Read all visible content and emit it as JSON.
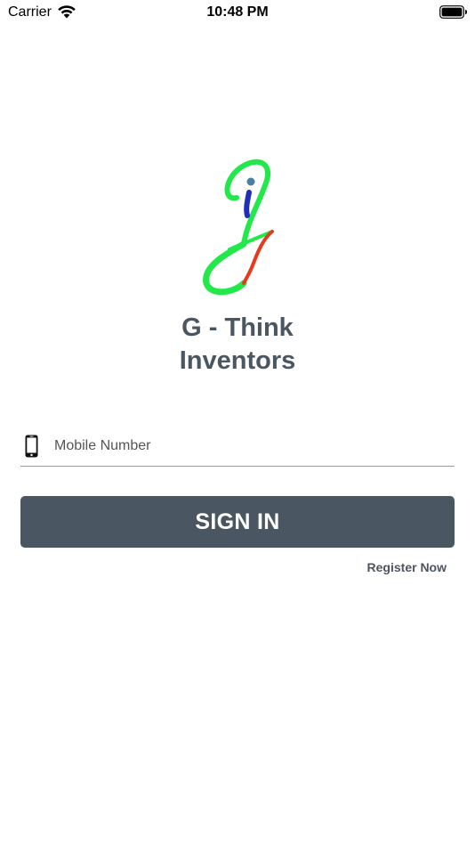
{
  "status_bar": {
    "carrier": "Carrier",
    "time": "10:48 PM",
    "wifi_icon": "wifi-icon",
    "battery_icon": "battery-icon"
  },
  "logo": {
    "icon": "g-think-logo",
    "colors": {
      "green": "#22e84a",
      "blue": "#1f2fb8",
      "red": "#e8391c"
    }
  },
  "app": {
    "title_line1": "G - Think",
    "title_line2": "Inventors"
  },
  "login": {
    "mobile_icon": "smartphone-icon",
    "mobile_placeholder": "Mobile Number",
    "mobile_value": "",
    "signin_label": "SIGN IN",
    "register_label": "Register Now"
  },
  "colors": {
    "primary": "#4a5661",
    "background": "#ffffff"
  }
}
